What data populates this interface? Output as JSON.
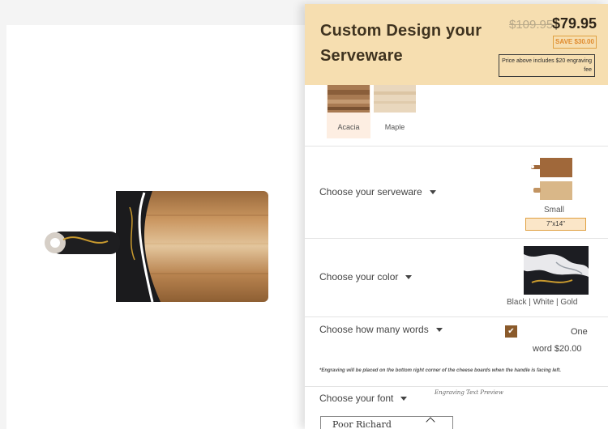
{
  "header": {
    "title": "Custom Design your Serveware",
    "old_price": "$109.95",
    "new_price": "$79.95",
    "save_badge": "SAVE $30.00",
    "fee_note": "Price above includes $20 engraving fee"
  },
  "wood_options": [
    {
      "label": "Acacia",
      "selected": true
    },
    {
      "label": "Maple",
      "selected": false
    }
  ],
  "serveware": {
    "label": "Choose your serveware",
    "selected_size": "Small",
    "size_dims": "7\"x14\""
  },
  "color": {
    "label": "Choose your color",
    "selected": "Black | White | Gold"
  },
  "words": {
    "label": "Choose how many words",
    "checked": true,
    "line1": "One",
    "line2": "word  $20.00",
    "note": "*Engraving will be placed on the bottom right corner of the cheese boards when the handle is facing left."
  },
  "font": {
    "label": "Choose your font",
    "preview_label": "Engraving Text Preview",
    "selected": "Poor Richard"
  },
  "icons": [
    "chevron-up-icon",
    "checkmark-icon",
    "caret-down-icon"
  ],
  "colors": {
    "header_bg": "#f6deb0",
    "accent": "#e0a040",
    "checkbox": "#8a5a2b"
  }
}
